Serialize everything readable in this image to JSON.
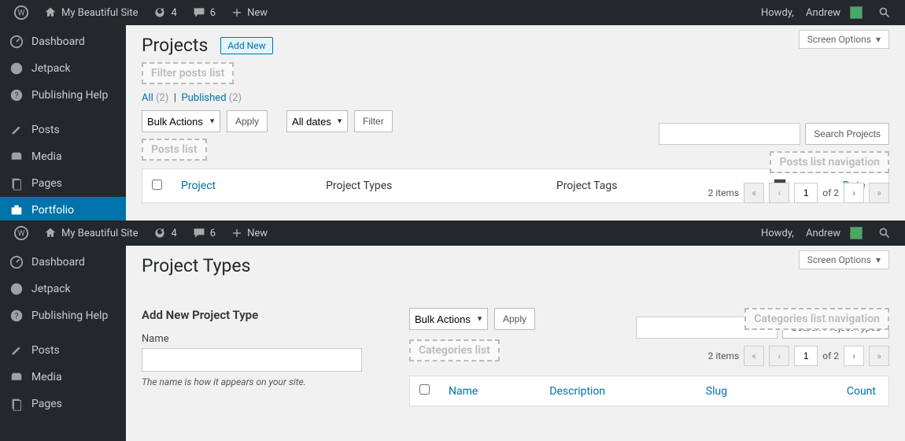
{
  "topbar": {
    "site_name": "My Beautiful Site",
    "refresh_count": "4",
    "comments_count": "6",
    "new_label": "New",
    "howdy_prefix": "Howdy,",
    "user_name": "Andrew"
  },
  "sidebar": {
    "dashboard": "Dashboard",
    "jetpack": "Jetpack",
    "publishing_help": "Publishing Help",
    "posts": "Posts",
    "media": "Media",
    "pages": "Pages",
    "portfolio": "Portfolio"
  },
  "screen_options": "Screen Options",
  "shot1": {
    "title": "Projects",
    "add_new": "Add New",
    "ghost_filter": "Filter posts list",
    "subsub_all": "All",
    "subsub_all_cnt": "(2)",
    "subsub_sep": "|",
    "subsub_pub": "Published",
    "subsub_pub_cnt": "(2)",
    "bulk_sel": "Bulk Actions",
    "apply": "Apply",
    "dates_sel": "All dates",
    "filter": "Filter",
    "search_btn": "Search Projects",
    "ghost_nav": "Posts list navigation",
    "ghost_list": "Posts list",
    "items_label": "2 items",
    "page_val": "1",
    "page_of": "of 2",
    "cols": {
      "title": "Project",
      "types": "Project Types",
      "tags": "Project Tags",
      "date": "Date"
    }
  },
  "shot2": {
    "title": "Project Types",
    "search_btn": "Search Project Types",
    "form_heading": "Add New Project Type",
    "name_label": "Name",
    "name_hint": "The name is how it appears on your site.",
    "bulk_sel": "Bulk Actions",
    "apply": "Apply",
    "ghost_nav": "Categories list navigation",
    "ghost_list": "Categories list",
    "items_label": "2 items",
    "page_val": "1",
    "page_of": "of 2",
    "cols": {
      "name": "Name",
      "desc": "Description",
      "slug": "Slug",
      "count": "Count"
    }
  }
}
